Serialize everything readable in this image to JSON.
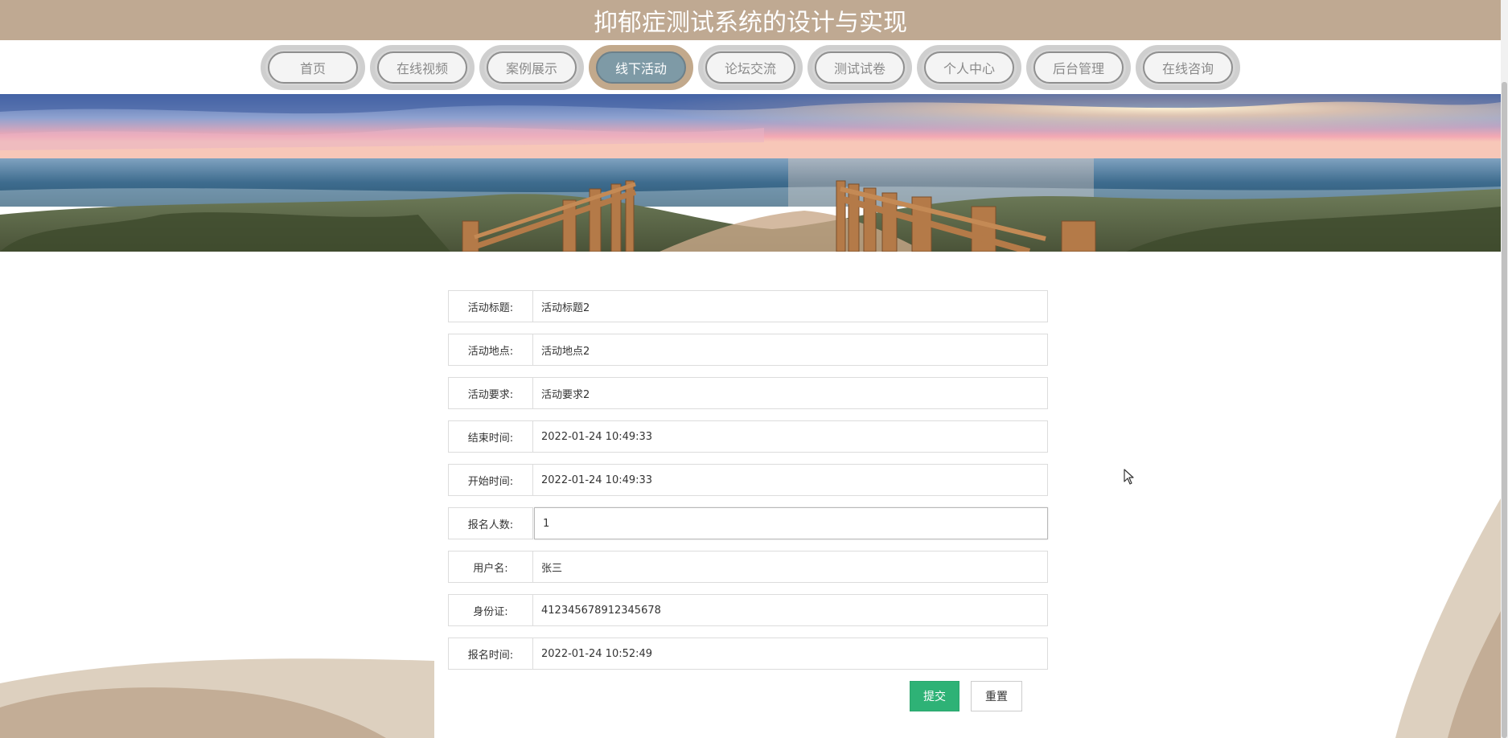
{
  "header": {
    "title": "抑郁症测试系统的设计与实现"
  },
  "nav": {
    "items": [
      {
        "label": "首页",
        "active": false
      },
      {
        "label": "在线视频",
        "active": false
      },
      {
        "label": "案例展示",
        "active": false
      },
      {
        "label": "线下活动",
        "active": true
      },
      {
        "label": "论坛交流",
        "active": false
      },
      {
        "label": "测试试卷",
        "active": false
      },
      {
        "label": "个人中心",
        "active": false
      },
      {
        "label": "后台管理",
        "active": false
      },
      {
        "label": "在线咨询",
        "active": false
      }
    ]
  },
  "form": {
    "fields": [
      {
        "label": "活动标题:",
        "value": "活动标题2"
      },
      {
        "label": "活动地点:",
        "value": "活动地点2"
      },
      {
        "label": "活动要求:",
        "value": "活动要求2"
      },
      {
        "label": "结束时间:",
        "value": "2022-01-24 10:49:33"
      },
      {
        "label": "开始时间:",
        "value": "2022-01-24 10:49:33"
      },
      {
        "label": "报名人数:",
        "value": "1"
      },
      {
        "label": "用户名:",
        "value": "张三"
      },
      {
        "label": "身份证:",
        "value": "412345678912345678"
      },
      {
        "label": "报名时间:",
        "value": "2022-01-24 10:52:49"
      }
    ],
    "submit_label": "提交",
    "reset_label": "重置"
  },
  "colors": {
    "header_bg": "#bfa992",
    "nav_active_bg": "#7e9aa6",
    "submit_bg": "#2eb276"
  }
}
